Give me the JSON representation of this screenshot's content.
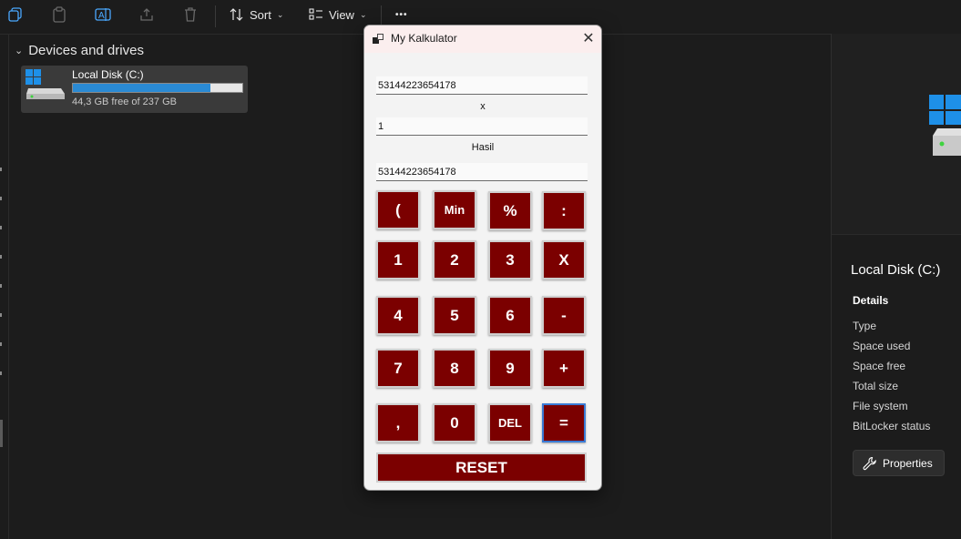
{
  "toolbar": {
    "sort_label": "Sort",
    "view_label": "View",
    "more_label": "•••"
  },
  "explorer": {
    "section_title": "Devices and drives",
    "drive": {
      "name": "Local Disk (C:)",
      "free_text": "44,3 GB free of 237 GB",
      "used_fraction": 0.813,
      "bar_color": "#2a8ad4"
    }
  },
  "details": {
    "title": "Local Disk (C:)",
    "subtitle": "Details",
    "rows": [
      "Type",
      "Space used",
      "Space free",
      "Total size",
      "File system",
      "BitLocker status"
    ],
    "properties_label": "Properties"
  },
  "calculator": {
    "title": "My Kalkulator",
    "operand1": "53144223654178",
    "operator": "x",
    "operand2": "1",
    "result_label": "Hasil",
    "result": "53144223654178",
    "keys": [
      [
        "(",
        "Min",
        "%",
        ":"
      ],
      [
        "1",
        "2",
        "3",
        "X"
      ],
      [
        "4",
        "5",
        "6",
        "-"
      ],
      [
        "7",
        "8",
        "9",
        "+"
      ],
      [
        ",",
        "0",
        "DEL",
        "="
      ]
    ],
    "reset_label": "RESET",
    "key_color": "#7b0000",
    "focus_color": "#3a7bd5"
  }
}
